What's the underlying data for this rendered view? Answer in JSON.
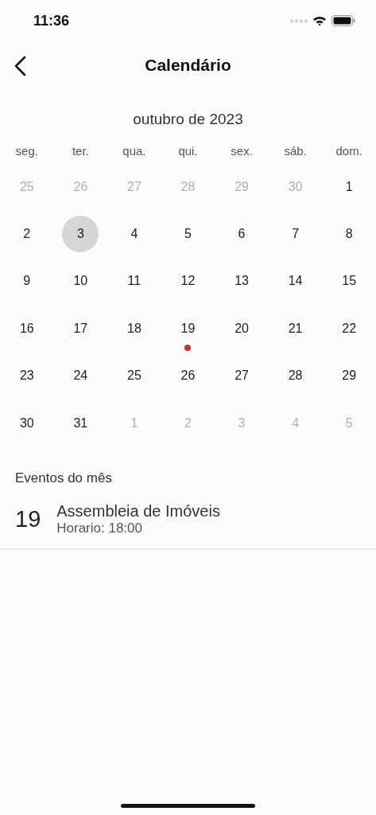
{
  "status_bar": {
    "time": "11:36"
  },
  "nav": {
    "title": "Calendário"
  },
  "calendar": {
    "month": "outubro de 2023",
    "weekdays": [
      "seg.",
      "ter.",
      "qua.",
      "qui.",
      "sex.",
      "sáb.",
      "dom."
    ],
    "days": [
      {
        "label": "25",
        "outside": true,
        "selected": false,
        "has_event": false
      },
      {
        "label": "26",
        "outside": true,
        "selected": false,
        "has_event": false
      },
      {
        "label": "27",
        "outside": true,
        "selected": false,
        "has_event": false
      },
      {
        "label": "28",
        "outside": true,
        "selected": false,
        "has_event": false
      },
      {
        "label": "29",
        "outside": true,
        "selected": false,
        "has_event": false
      },
      {
        "label": "30",
        "outside": true,
        "selected": false,
        "has_event": false
      },
      {
        "label": "1",
        "outside": false,
        "selected": false,
        "has_event": false
      },
      {
        "label": "2",
        "outside": false,
        "selected": false,
        "has_event": false
      },
      {
        "label": "3",
        "outside": false,
        "selected": true,
        "has_event": false
      },
      {
        "label": "4",
        "outside": false,
        "selected": false,
        "has_event": false
      },
      {
        "label": "5",
        "outside": false,
        "selected": false,
        "has_event": false
      },
      {
        "label": "6",
        "outside": false,
        "selected": false,
        "has_event": false
      },
      {
        "label": "7",
        "outside": false,
        "selected": false,
        "has_event": false
      },
      {
        "label": "8",
        "outside": false,
        "selected": false,
        "has_event": false
      },
      {
        "label": "9",
        "outside": false,
        "selected": false,
        "has_event": false
      },
      {
        "label": "10",
        "outside": false,
        "selected": false,
        "has_event": false
      },
      {
        "label": "11",
        "outside": false,
        "selected": false,
        "has_event": false
      },
      {
        "label": "12",
        "outside": false,
        "selected": false,
        "has_event": false
      },
      {
        "label": "13",
        "outside": false,
        "selected": false,
        "has_event": false
      },
      {
        "label": "14",
        "outside": false,
        "selected": false,
        "has_event": false
      },
      {
        "label": "15",
        "outside": false,
        "selected": false,
        "has_event": false
      },
      {
        "label": "16",
        "outside": false,
        "selected": false,
        "has_event": false
      },
      {
        "label": "17",
        "outside": false,
        "selected": false,
        "has_event": false
      },
      {
        "label": "18",
        "outside": false,
        "selected": false,
        "has_event": false
      },
      {
        "label": "19",
        "outside": false,
        "selected": false,
        "has_event": true
      },
      {
        "label": "20",
        "outside": false,
        "selected": false,
        "has_event": false
      },
      {
        "label": "21",
        "outside": false,
        "selected": false,
        "has_event": false
      },
      {
        "label": "22",
        "outside": false,
        "selected": false,
        "has_event": false
      },
      {
        "label": "23",
        "outside": false,
        "selected": false,
        "has_event": false
      },
      {
        "label": "24",
        "outside": false,
        "selected": false,
        "has_event": false
      },
      {
        "label": "25",
        "outside": false,
        "selected": false,
        "has_event": false
      },
      {
        "label": "26",
        "outside": false,
        "selected": false,
        "has_event": false
      },
      {
        "label": "27",
        "outside": false,
        "selected": false,
        "has_event": false
      },
      {
        "label": "28",
        "outside": false,
        "selected": false,
        "has_event": false
      },
      {
        "label": "29",
        "outside": false,
        "selected": false,
        "has_event": false
      },
      {
        "label": "30",
        "outside": false,
        "selected": false,
        "has_event": false
      },
      {
        "label": "31",
        "outside": false,
        "selected": false,
        "has_event": false
      },
      {
        "label": "1",
        "outside": true,
        "selected": false,
        "has_event": false
      },
      {
        "label": "2",
        "outside": true,
        "selected": false,
        "has_event": false
      },
      {
        "label": "3",
        "outside": true,
        "selected": false,
        "has_event": false
      },
      {
        "label": "4",
        "outside": true,
        "selected": false,
        "has_event": false
      },
      {
        "label": "5",
        "outside": true,
        "selected": false,
        "has_event": false
      }
    ]
  },
  "events": {
    "heading": "Eventos do mês",
    "items": [
      {
        "day": "19",
        "title": "Assembleia de Imóveis",
        "time": "Horario: 18:00"
      }
    ]
  }
}
